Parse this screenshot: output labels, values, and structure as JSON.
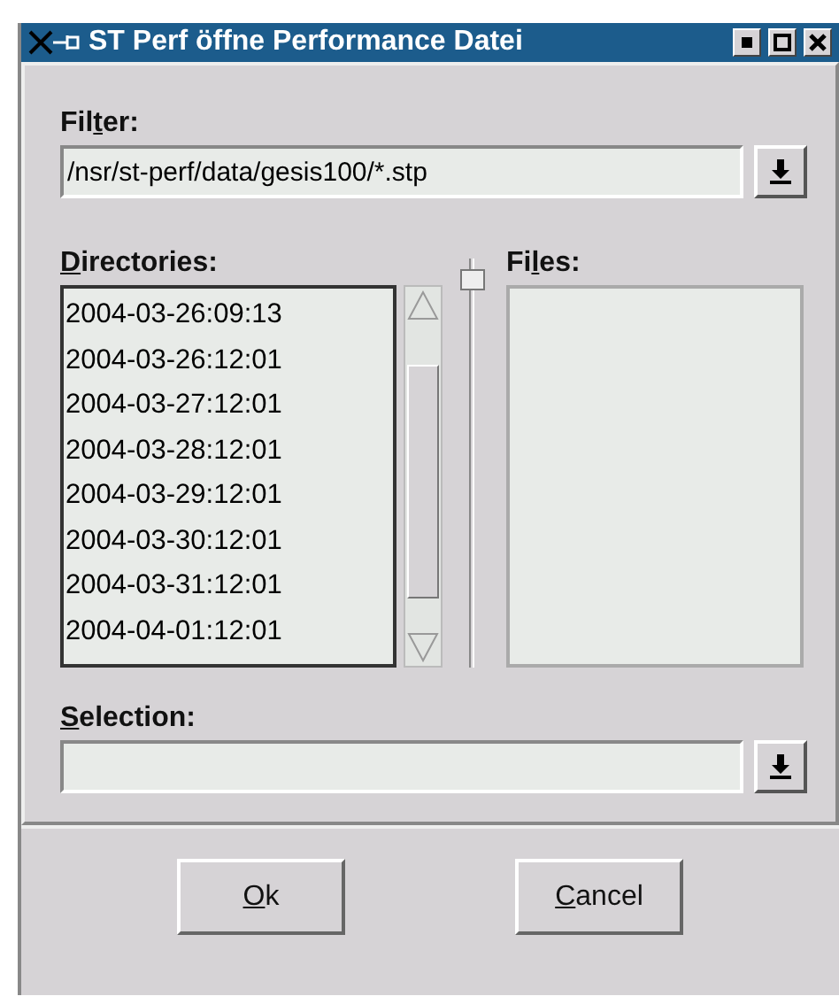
{
  "window": {
    "title": "ST Perf öffne Performance Datei"
  },
  "filter": {
    "label_start": "Fil",
    "mnemonic": "t",
    "label_end": "er:",
    "value": "/nsr/st-perf/data/gesis100/*.stp"
  },
  "directories": {
    "mnemonic": "D",
    "label_end": "irectories:",
    "items": [
      {
        "text": "2004-03-26:09:13"
      },
      {
        "text": "2004-03-26:12:01"
      },
      {
        "text": "2004-03-27:12:01"
      },
      {
        "text": "2004-03-28:12:01"
      },
      {
        "text": "2004-03-29:12:01"
      },
      {
        "text": "2004-03-30:12:01"
      },
      {
        "text": "2004-03-31:12:01"
      },
      {
        "text": "2004-04-01:12:01"
      }
    ]
  },
  "files": {
    "label_start": "Fi",
    "mnemonic": "l",
    "label_end": "es:"
  },
  "selection": {
    "mnemonic": "S",
    "label_end": "election:"
  },
  "buttons": [
    {
      "mnemonic": "O",
      "label_end": "k"
    },
    {
      "mnemonic": "C",
      "label_end": "ancel"
    }
  ]
}
